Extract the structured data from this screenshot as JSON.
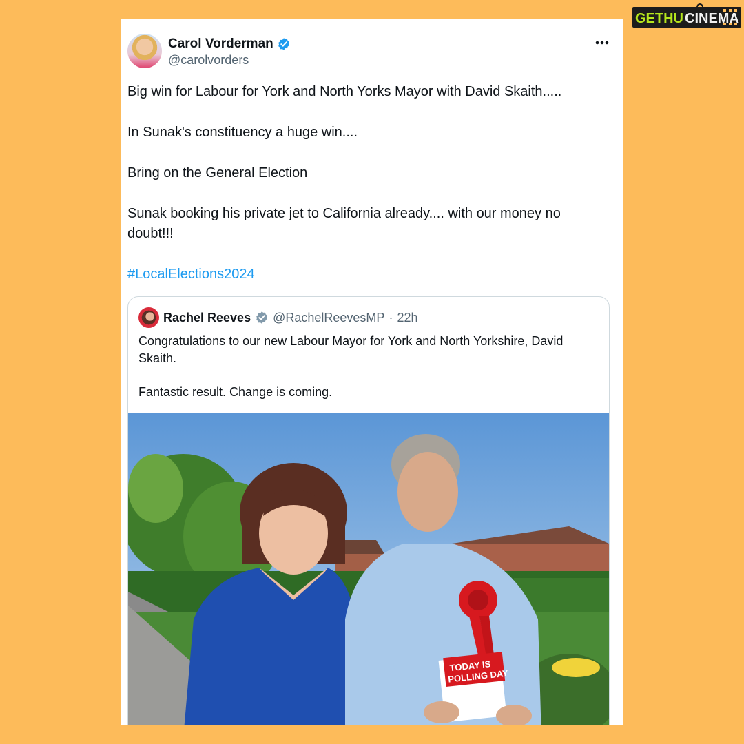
{
  "watermark": {
    "text_a": "GETHU",
    "text_b": "CINEMA"
  },
  "tweet": {
    "author_name": "Carol Vorderman",
    "author_handle": "@carolvorders",
    "paragraphs": [
      "Big win for Labour for York and North Yorks Mayor with David Skaith.....",
      "In Sunak's constituency a huge win....",
      "Bring on the General Election",
      "Sunak booking his private jet to California already.... with our money no doubt!!!"
    ],
    "hashtag": "#LocalElections2024",
    "more_icon": "more-horizontal-icon"
  },
  "quote": {
    "author_name": "Rachel Reeves",
    "author_handle": "@RachelReevesMP",
    "separator": "·",
    "time": "22h",
    "paragraphs": [
      "Congratulations to our new Labour Mayor for York and North Yorkshire, David Skaith.",
      "Fantastic result. Change is coming."
    ],
    "photo": {
      "leaflet_line1": "TODAY IS",
      "leaflet_line2": "POLLING DAY"
    }
  },
  "colors": {
    "background": "#FDBB5A",
    "verified": "#1d9bf0",
    "hashtag": "#1d9bf0",
    "watermark_green": "#b5e61d"
  }
}
